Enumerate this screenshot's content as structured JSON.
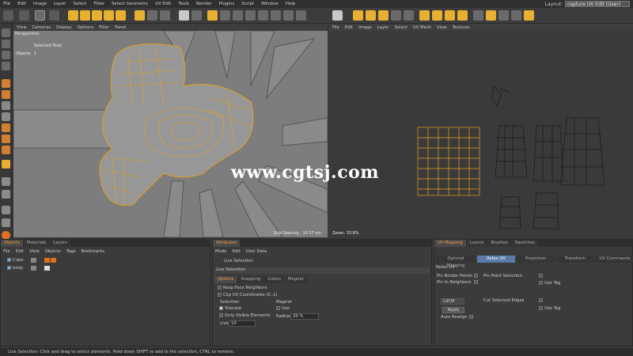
{
  "menubar": {
    "items": [
      "File",
      "Edit",
      "Image",
      "Layer",
      "Select",
      "Filter",
      "Select Geometry",
      "UV Edit",
      "Tools",
      "Render",
      "Plugins",
      "Script",
      "Window",
      "Help"
    ],
    "layout_label": "Layout:",
    "layout_value": "capture UV Edit (User)"
  },
  "viewport_left": {
    "menu": [
      "View",
      "Cameras",
      "Display",
      "Options",
      "Filter",
      "Panel"
    ],
    "camera_label": "Perspective",
    "hud_header": "Selected Total",
    "hud_row_label": "Objects",
    "hud_row_value": "1",
    "grid_spacing": "Grid Spacing : 10.37 cm"
  },
  "viewport_right": {
    "menu": [
      "File",
      "Edit",
      "Image",
      "Layer",
      "Select",
      "UV Mesh",
      "View",
      "Textures"
    ],
    "zoom": "Zoom: 33.8%"
  },
  "watermark": "www.cgtsj.com",
  "objects_panel": {
    "tabs": [
      "Objects",
      "Materials",
      "Layers"
    ],
    "menu": [
      "File",
      "Edit",
      "View",
      "Objects",
      "Tags",
      "Bookmarks"
    ],
    "items": [
      {
        "name": "Cube"
      },
      {
        "name": "body"
      }
    ]
  },
  "attributes_panel": {
    "tab": "Attributes",
    "menu": [
      "Mode",
      "Edit",
      "User Data"
    ],
    "title": "Live Selection",
    "section": "Live Selection",
    "subtabs": [
      "Options",
      "Snapping",
      "Colors",
      "Magnet"
    ],
    "options": {
      "keep_face_neighbors": "Keep Face Neighbors",
      "clip_uv": "Clip UV Coordinates (0..1)",
      "selection_label": "Selection",
      "tolerant": "Tolerant",
      "only_visible": "Only Visible Elements",
      "live_label": "Live",
      "live_value": "10",
      "magnet_label": "Magnet",
      "use_label": "Use",
      "radius_label": "Radius",
      "radius_value": "20 %"
    }
  },
  "uv_panel": {
    "tabs": [
      "UV Mapping",
      "Layers",
      "Brushes",
      "Swatches"
    ],
    "mode_tabs": [
      "Optimal Mapping",
      "Relax UV",
      "Projection",
      "Transform",
      "UV Commands"
    ],
    "section": "Relax UV",
    "pin_border": "Pin Border Points",
    "pin_point_selection": "Pin Point Selection",
    "pin_neighbors": "Pin to Neighbors",
    "use_tag_1": "Use Tag",
    "algorithm": "LSCM",
    "apply": "Apply",
    "cut_edges": "Cut Selected Edges",
    "use_tag_2": "Use Tag",
    "auto_realign": "Auto Realign"
  },
  "statusbar": {
    "text": "Live Selection: Click and drag to select elements. Hold down SHIFT to add to the selection, CTRL to remove."
  }
}
